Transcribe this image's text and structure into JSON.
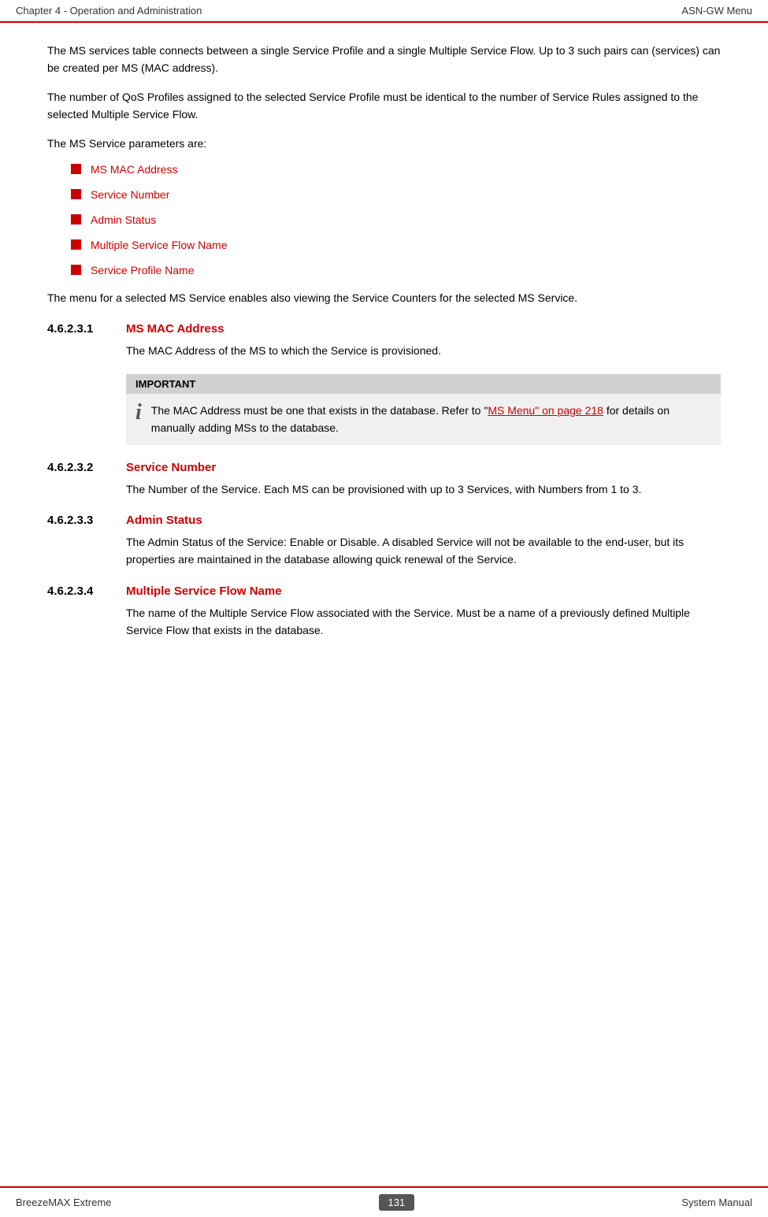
{
  "header": {
    "left": "Chapter 4 - Operation and Administration",
    "right": "ASN-GW Menu"
  },
  "footer": {
    "left": "BreezeMAX Extreme",
    "center": "131",
    "right": "System Manual"
  },
  "intro_paragraphs": [
    "The MS services table connects between a single Service Profile and a single Multiple Service Flow. Up to 3 such pairs can (services) can be created per MS (MAC address).",
    "The number of QoS Profiles assigned to the selected Service Profile must be identical to the number of Service Rules assigned to the selected Multiple Service Flow.",
    "The MS Service parameters are:"
  ],
  "bullet_items": [
    "MS MAC Address",
    "Service Number",
    "Admin Status",
    "Multiple Service Flow Name",
    "Service Profile Name"
  ],
  "after_bullets_text": "The menu for a selected MS Service enables also viewing the Service Counters for the selected MS Service.",
  "sections": [
    {
      "number": "4.6.2.3.1",
      "title": "MS MAC Address",
      "body": "The MAC Address of the MS to which the Service is provisioned.",
      "important": {
        "label": "IMPORTANT",
        "text": "The MAC Address must be one that exists in the database. Refer to ““MS Menu” on page 218 for details on manually adding MSs to the database.",
        "link_text": "“MS Menu” on page 218"
      }
    },
    {
      "number": "4.6.2.3.2",
      "title": "Service Number",
      "body": "The Number of the Service. Each MS can be provisioned with up to 3 Services, with Numbers from 1 to 3.",
      "important": null
    },
    {
      "number": "4.6.2.3.3",
      "title": "Admin Status",
      "body": "The Admin Status of the Service: Enable or Disable. A disabled Service will not be available to the end-user, but its properties are maintained in the database allowing quick renewal of the Service.",
      "important": null
    },
    {
      "number": "4.6.2.3.4",
      "title": "Multiple Service Flow Name",
      "body": "The name of the Multiple Service Flow associated with the Service. Must be a name of a previously defined Multiple Service Flow that exists in the database.",
      "important": null
    }
  ]
}
